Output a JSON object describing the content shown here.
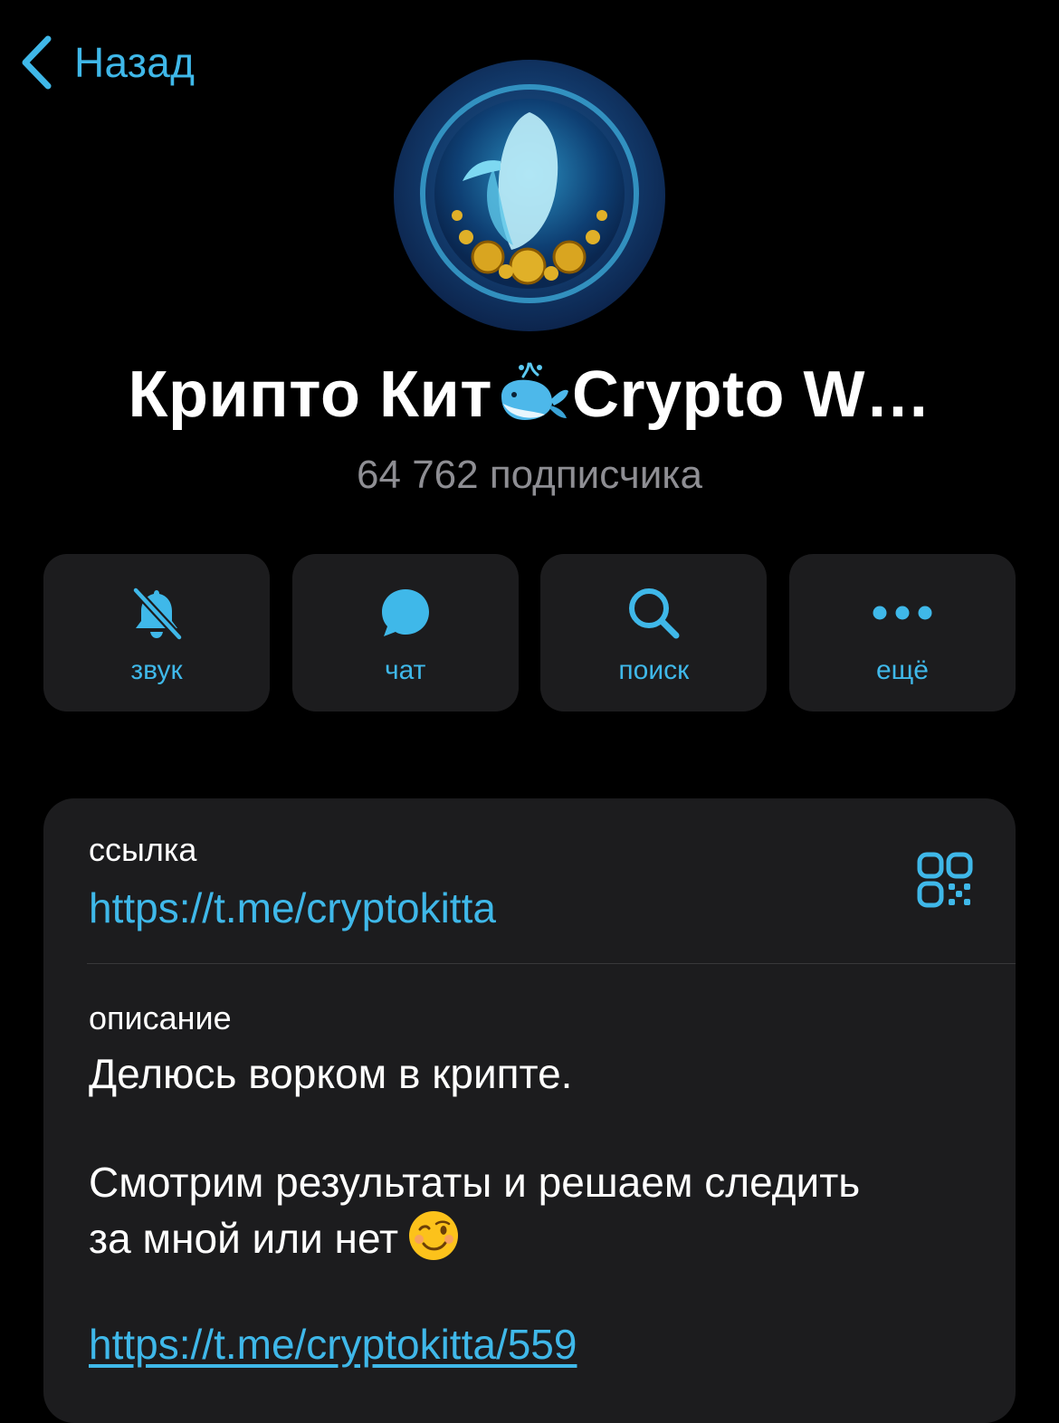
{
  "nav": {
    "back_label": "Назад"
  },
  "channel": {
    "title_part1": "Крипто Кит",
    "title_emoji": "whale-emoji",
    "title_part2": "Crypto W…",
    "subscribers": "64 762 подписчика"
  },
  "actions": [
    {
      "label": "звук",
      "icon": "bell-slash-icon"
    },
    {
      "label": "чат",
      "icon": "chat-bubble-icon"
    },
    {
      "label": "поиск",
      "icon": "search-icon"
    },
    {
      "label": "ещё",
      "icon": "more-dots-icon"
    }
  ],
  "info": {
    "link_label": "ссылка",
    "link_value": "https://t.me/cryptokitta",
    "description_label": "описание",
    "description_line1": "Делюсь ворком в крипте.",
    "description_line2": "Смотрим результаты и решаем следить",
    "description_line3": "за мной или нет",
    "description_emoji": "winking-face-emoji",
    "description_link": "https://t.me/cryptokitta/559"
  },
  "colors": {
    "accent": "#3fb8e9",
    "background": "#000000",
    "card": "#1c1c1e",
    "secondary_text": "#8e8e93"
  }
}
